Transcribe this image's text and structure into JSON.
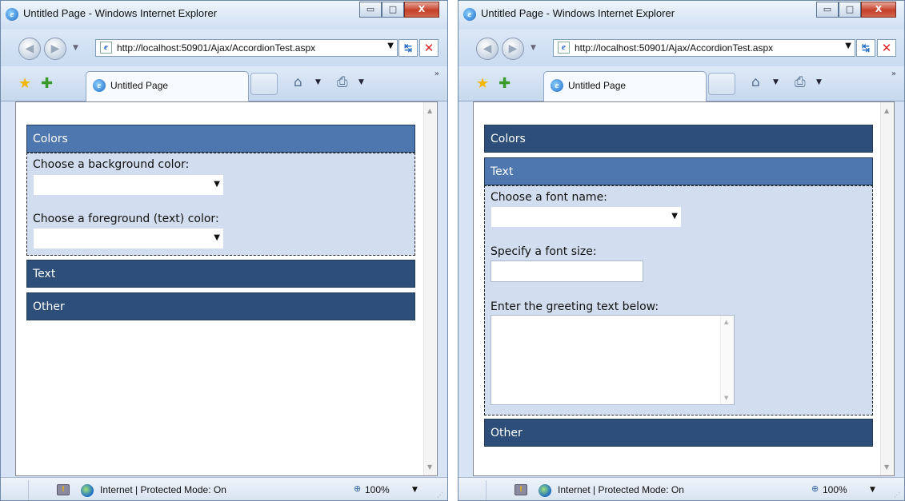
{
  "browser": {
    "title": "Untitled Page - Windows Internet Explorer",
    "address": "http://localhost:50901/Ajax/AccordionTest.aspx",
    "tab_label": "Untitled Page",
    "status_text": "Internet | Protected Mode: On",
    "zoom": "100%",
    "window_buttons": {
      "minimize": "▭",
      "maximize": "□",
      "close": "X"
    }
  },
  "left": {
    "accordion": {
      "colors_header": "Colors",
      "background_label": "Choose a background color:",
      "foreground_label": "Choose a foreground (text) color:",
      "text_header": "Text",
      "other_header": "Other"
    }
  },
  "right": {
    "accordion": {
      "colors_header": "Colors",
      "text_header": "Text",
      "font_name_label": "Choose a font name:",
      "font_size_label": "Specify a font size:",
      "greeting_label": "Enter the greeting text below:",
      "other_header": "Other"
    }
  },
  "colors": {
    "active_header": "#4e77b0",
    "inactive_header": "#2c4e78",
    "panel_bg": "#d2ddef"
  }
}
